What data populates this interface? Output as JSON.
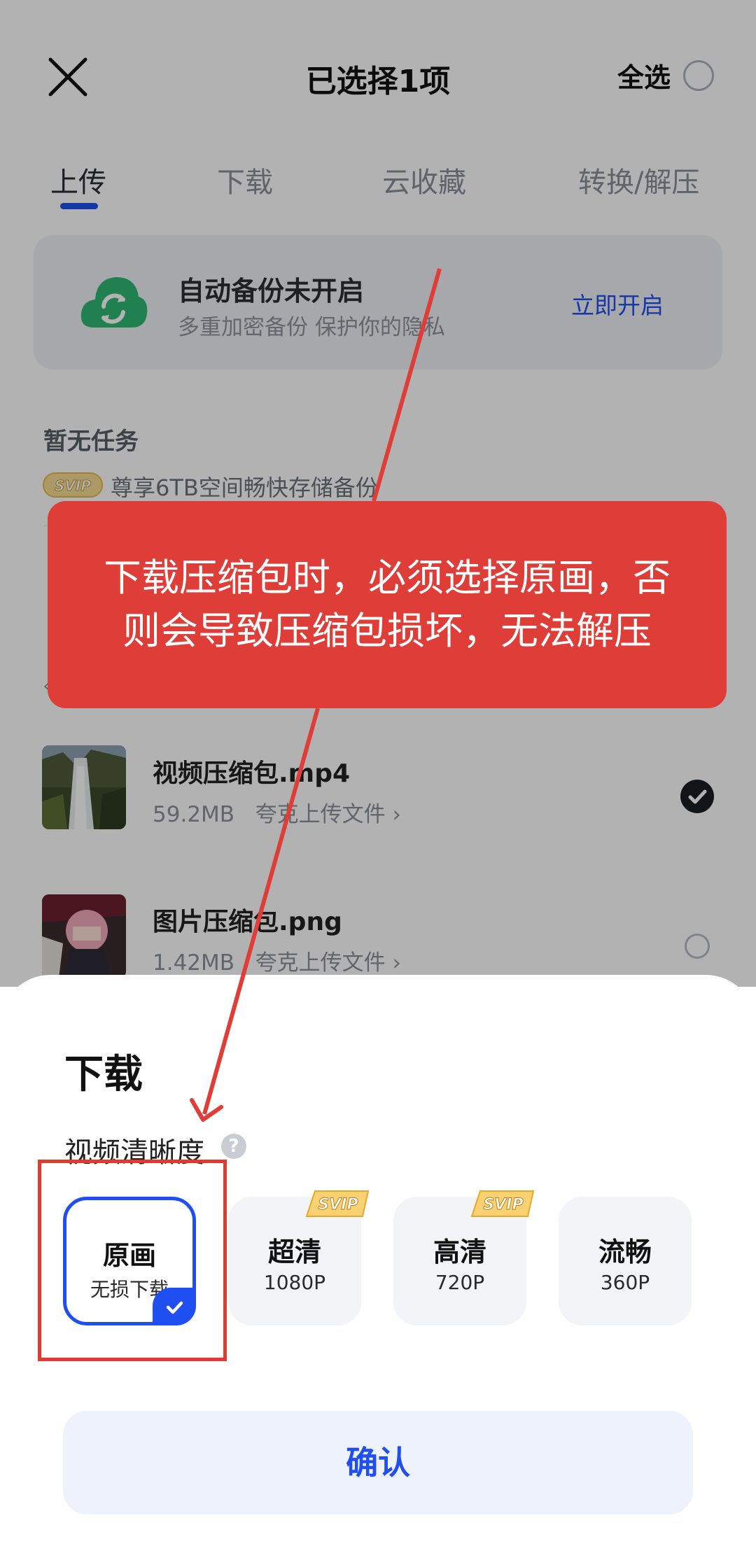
{
  "header": {
    "title": "已选择1项",
    "select_all": "全选"
  },
  "tabs": [
    {
      "label": "上传",
      "active": true
    },
    {
      "label": "下载",
      "active": false
    },
    {
      "label": "云收藏",
      "active": false
    },
    {
      "label": "转换/解压",
      "active": false
    }
  ],
  "backup": {
    "title": "自动备份未开启",
    "subtitle": "多重加密备份 保护你的隐私",
    "action": "立即开启"
  },
  "tasks": {
    "empty_label": "暂无任务",
    "svip_badge": "SVIP",
    "svip_promo": "尊享6TB空间畅快存储备份"
  },
  "files": [
    {
      "name": "视频压缩包.mp4",
      "size": "59.2MB",
      "source": "夸克上传文件 ›",
      "selected": true
    },
    {
      "name": "图片压缩包.png",
      "size": "1.42MB",
      "source": "夸克上传文件 ›",
      "selected": false
    }
  ],
  "sheet": {
    "title": "下载",
    "clarity_label": "视频清晰度",
    "help_icon": "?",
    "options": [
      {
        "name": "原画",
        "sub": "无损下载",
        "selected": true,
        "svip": false
      },
      {
        "name": "超清",
        "sub": "1080P",
        "selected": false,
        "svip": true,
        "badge": "SVIP"
      },
      {
        "name": "高清",
        "sub": "720P",
        "selected": false,
        "svip": true,
        "badge": "SVIP"
      },
      {
        "name": "流畅",
        "sub": "360P",
        "selected": false,
        "svip": false
      }
    ],
    "confirm": "确认"
  },
  "annotation": {
    "line1": "下载压缩包时，必须选择原画，否",
    "line2": "则会导致压缩包损坏，无法解压"
  },
  "colors": {
    "accent": "#1f4ff0",
    "annotation_red": "#df3d37",
    "svip_gold": "#f2b53a"
  }
}
